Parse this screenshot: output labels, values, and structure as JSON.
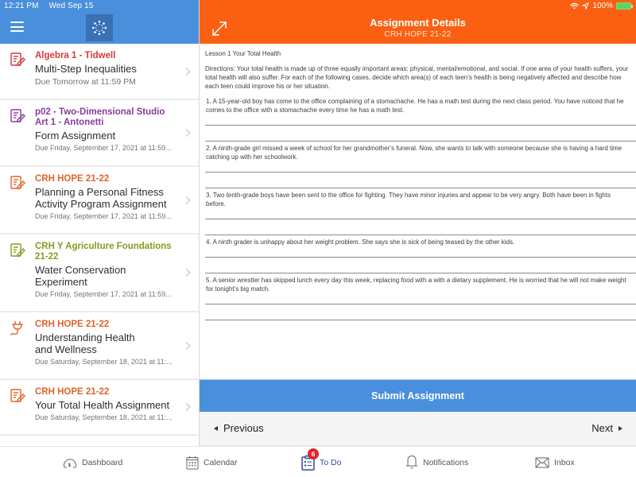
{
  "status_bar": {
    "time": "12:21 PM",
    "date": "Wed Sep 15",
    "battery": "100%",
    "icons": [
      "wifi-icon",
      "location-arrow-icon",
      "battery-charging-icon"
    ]
  },
  "left_header": {
    "menu_icon": "hamburger-menu-icon",
    "logo_icon": "canvas-logo-icon"
  },
  "colors": {
    "brand_blue": "#4a8fdc",
    "header_orange": "#fb6012",
    "course_red": "#d9383a",
    "course_purple": "#8a3b9c",
    "course_orange": "#e0642a",
    "course_olive": "#8a9a1e",
    "badge_red": "#e0252b",
    "active_tab": "#2d4f9c"
  },
  "todo_items": [
    {
      "icon": "assignment-icon",
      "course": "Algebra 1 - Tidwell",
      "course_color": "#d9383a",
      "title": "Multi-Step Inequalities",
      "due": "Due Tomorrow at 11:59 PM"
    },
    {
      "icon": "assignment-icon",
      "course": "p02 - Two-Dimensional Studio Art 1 - Antonetti",
      "course_color": "#8a3b9c",
      "title": "Form Assignment",
      "due": "Due Friday, September 17, 2021 at 11:59..."
    },
    {
      "icon": "assignment-icon",
      "course": "CRH  HOPE 21-22",
      "course_color": "#e0642a",
      "title": "Planning a Personal Fitness Activity Program Assignment",
      "due": "Due Friday, September 17, 2021 at 11:59..."
    },
    {
      "icon": "assignment-icon",
      "course": "CRH Y Agriculture Foundations 21-22",
      "course_color": "#8a9a1e",
      "title": "Water Conservation Experiment",
      "due": "Due Friday, September 17, 2021 at 11:59..."
    },
    {
      "icon": "plug-icon",
      "course": "CRH  HOPE 21-22",
      "course_color": "#e0642a",
      "title": "Understanding Health and Wellness",
      "due": "Due Saturday, September 18, 2021 at 11:..."
    },
    {
      "icon": "assignment-icon",
      "course": "CRH  HOPE 21-22",
      "course_color": "#e0642a",
      "title": "Your Total Health Assignment",
      "due": "Due Saturday, September 18, 2021 at 11:..."
    }
  ],
  "detail_header": {
    "expand_icon": "expand-arrows-icon",
    "title": "Assignment Details",
    "subtitle": "CRH  HOPE 21-22"
  },
  "assignment": {
    "lesson": "Lesson 1 Your Total Health",
    "directions": "Directions: Your total health is made up of three equally important areas: physical, mental/emotional, and social. If one area of your health suffers, your total health will also suffer. For each of the following cases, decide which area(s) of each teen’s health is being negatively affected and describe how each teen could improve his or her situation.",
    "questions": [
      "1. A 15-year-old boy has come to the office complaining of a stomachache. He has a math test during the next class period. You have noticed that he comes to the office with a stomachache every time he has a math test.",
      "2. A ninth-grade girl missed a week of school for her grandmother’s funeral. Now, she wants to talk with someone because she is having a hard time catching up with her schoolwork.",
      "3. Two tenth-grade boys have been sent to the office for fighting. They have minor injuries and appear to be very angry. Both have been in fights before.",
      "4. A ninth grader is unhappy about her weight problem. She says she is sick of being teased by the other kids.",
      "5. A senior wrestler has skipped lunch every day this week, replacing food with a with a dietary supplement. He is worried that he will not make weight for tonight’s big match."
    ]
  },
  "actions": {
    "submit": "Submit Assignment",
    "previous": "Previous",
    "next": "Next"
  },
  "tab_bar": {
    "tabs": [
      {
        "label": "Dashboard",
        "icon": "dashboard-gauge-icon",
        "active": false
      },
      {
        "label": "Calendar",
        "icon": "calendar-icon",
        "active": false
      },
      {
        "label": "To Do",
        "icon": "todo-checklist-icon",
        "active": true,
        "badge": "6"
      },
      {
        "label": "Notifications",
        "icon": "bell-icon",
        "active": false
      },
      {
        "label": "Inbox",
        "icon": "envelope-icon",
        "active": false
      }
    ]
  }
}
